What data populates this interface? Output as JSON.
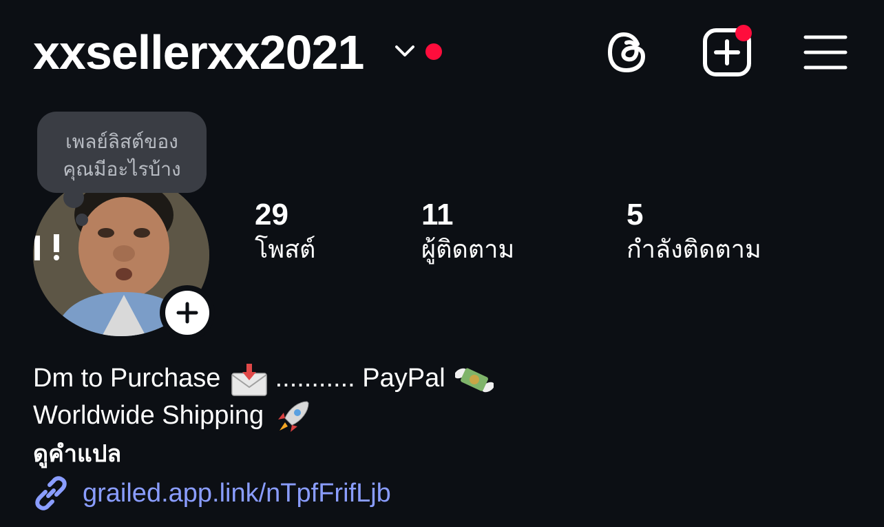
{
  "header": {
    "username": "xxsellerxx2021",
    "accent_dot_color": "#ff0d3c",
    "icons": [
      "chevron-down-icon",
      "threads-icon",
      "create-post-icon",
      "menu-icon"
    ]
  },
  "note": {
    "text_line1": "เพลย์ลิสต์ของ",
    "text_line2": "คุณมีอะไรบ้าง"
  },
  "stats": {
    "posts": {
      "count": "29",
      "label": "โพสต์"
    },
    "followers": {
      "count": "11",
      "label": "ผู้ติดตาม"
    },
    "following": {
      "count": "5",
      "label": "กำลังติดตาม"
    }
  },
  "bio": {
    "line1_part1": "Dm to Purchase",
    "line1_part2": "........... PayPal",
    "line2": "Worldwide Shipping",
    "emojis": [
      "envelope-with-arrow-icon",
      "money-with-wings-icon",
      "rocket-icon"
    ],
    "translate_label": "ดูคำแปล",
    "link": "grailed.app.link/nTpfFrifLjb",
    "link_color": "#8a9dff"
  }
}
